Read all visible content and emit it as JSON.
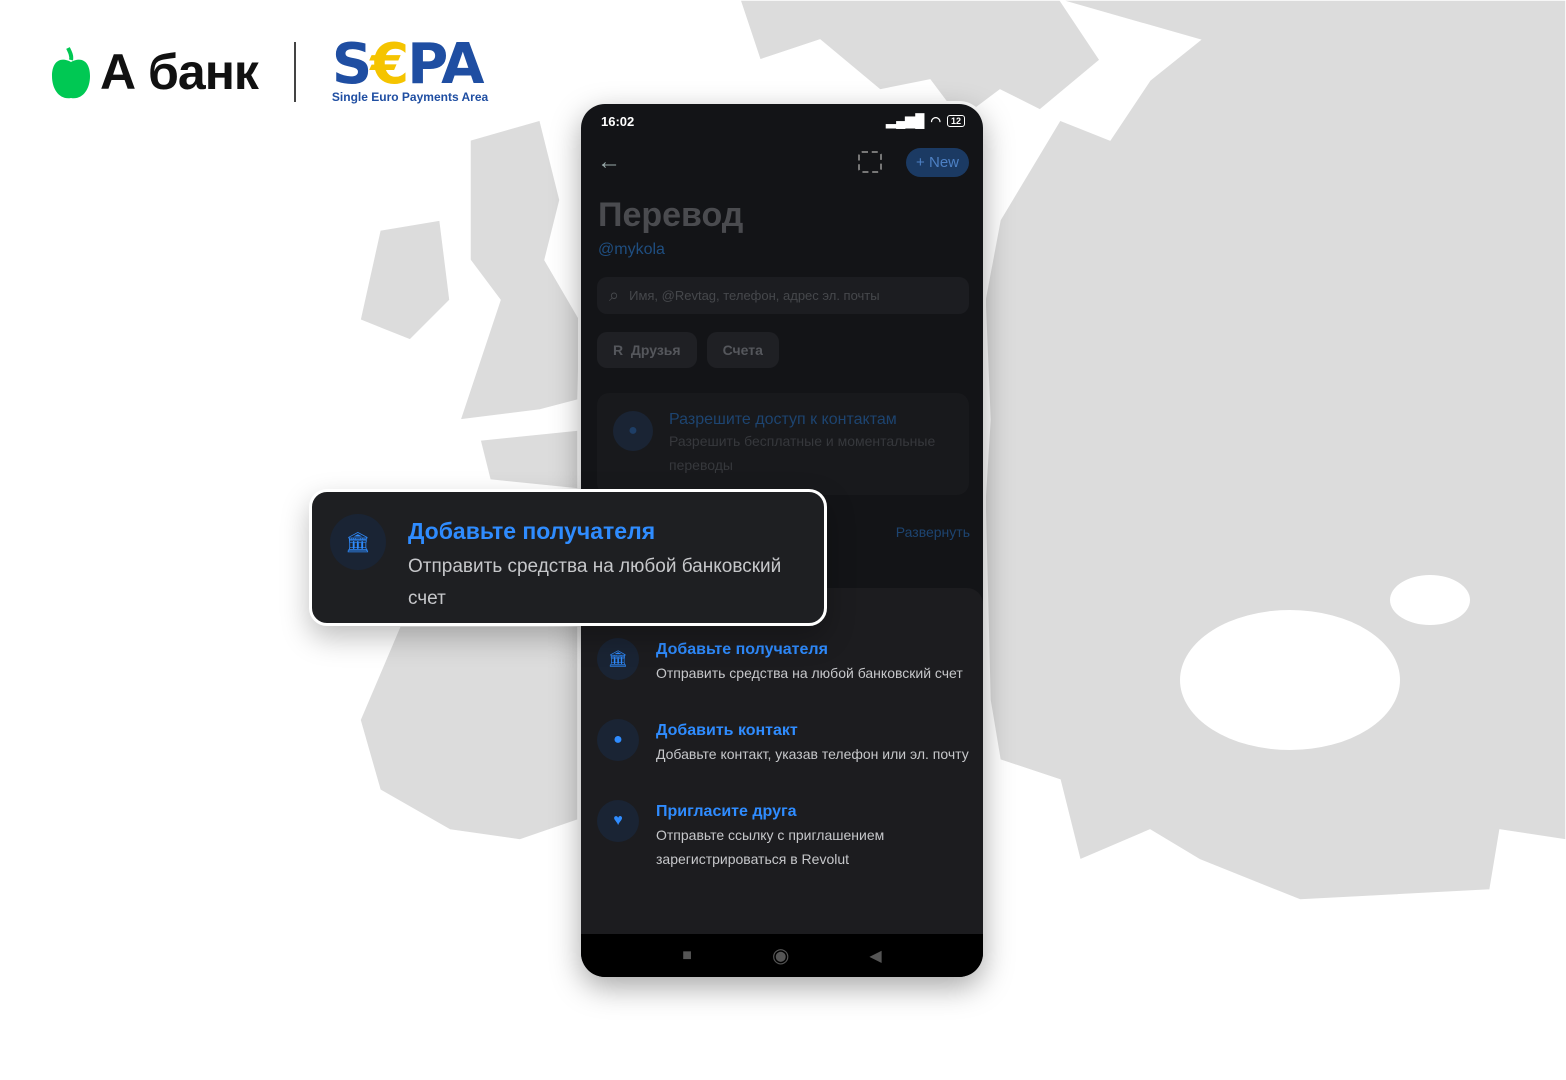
{
  "brand": {
    "abank": "А банк",
    "sepa_big_s": "S",
    "sepa_big_e": "€",
    "sepa_big_pa": "PA",
    "sepa_small": "Single Euro Payments Area"
  },
  "status": {
    "time": "16:02",
    "battery": "12"
  },
  "header": {
    "new_label": "New",
    "title": "Перевод",
    "handle": "@mykola"
  },
  "search": {
    "placeholder": "Имя, @Revtag, телефон, адрес эл. почты"
  },
  "chips": [
    {
      "label": "Друзья"
    },
    {
      "label": "Счета"
    }
  ],
  "contacts_card": {
    "title": "Разрешите доступ к контактам",
    "subtitle": "Разрешить бесплатные и моментальные переводы"
  },
  "expand_label": "Развернуть",
  "items": [
    {
      "icon": "bank-icon",
      "title": "Добавьте получателя",
      "subtitle": "Отправить средства на любой банковский счет"
    },
    {
      "icon": "person-icon",
      "title": "Добавить контакт",
      "subtitle": "Добавьте контакт, указав телефон или эл. почту"
    },
    {
      "icon": "heart-icon",
      "title": "Пригласите друга",
      "subtitle": "Отправьте ссылку с приглашением зарегистрироваться в Revolut"
    }
  ],
  "callout": {
    "title": "Добавьте получателя",
    "subtitle": "Отправить средства на любой банковский счет"
  },
  "colors": {
    "accent": "#2f8cff",
    "abank_green": "#00c853",
    "sepa_blue": "#1f4ea2",
    "sepa_yellow": "#f5c400"
  }
}
